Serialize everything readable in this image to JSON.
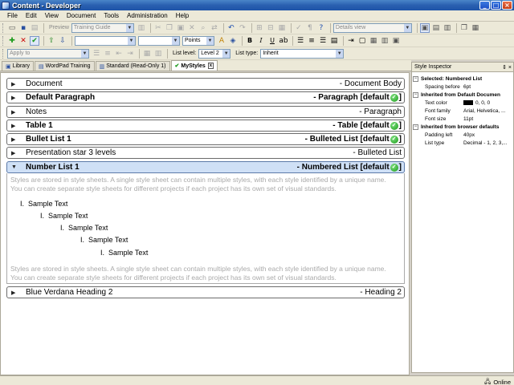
{
  "window": {
    "title": "Content - Developer",
    "buttons": {
      "minimize": "_",
      "maximize": "□",
      "close": "×"
    }
  },
  "menu": [
    "File",
    "Edit",
    "View",
    "Document",
    "Tools",
    "Administration",
    "Help"
  ],
  "toolbar1": {
    "preview_label": "Preview",
    "template_combo": "Training Guide",
    "view_combo": "Details view"
  },
  "toolbar2": {
    "style_combo": "",
    "size_combo": "",
    "units_combo": "Points",
    "bold": "B",
    "italic": "I",
    "underline": "U"
  },
  "toolbar3": {
    "apply_to_label": "Apply to",
    "list_level_label": "List level:",
    "list_level_value": "Level 2",
    "list_type_label": "List type:",
    "list_type_value": "Inherit"
  },
  "tabs": [
    {
      "label": "Library"
    },
    {
      "label": "WordPad Training"
    },
    {
      "label": "Standard (Read-Only 1)"
    },
    {
      "label": "MyStyles",
      "close": "x"
    }
  ],
  "sections": [
    {
      "name": "Document",
      "type": "- Document Body",
      "bold": false,
      "default": false
    },
    {
      "name": "Default Paragraph",
      "type": "- Paragraph [default",
      "bold": true,
      "default": true
    },
    {
      "name": "Notes",
      "type": "- Paragraph",
      "bold": false,
      "default": false
    },
    {
      "name": "Table 1",
      "type": "- Table [default",
      "bold": true,
      "default": true
    },
    {
      "name": "Bullet List 1",
      "type": "- Bulleted List [default",
      "bold": true,
      "default": true
    },
    {
      "name": "Presentation star 3 levels",
      "type": "- Bulleted List",
      "bold": false,
      "default": false
    },
    {
      "name": "Number List 1",
      "type": "- Numbered List [default",
      "bold": true,
      "default": true
    },
    {
      "name": "Blue Verdana Heading 2",
      "type": "- Heading 2",
      "bold": false,
      "default": false
    }
  ],
  "default_suffix": "]",
  "expanded": {
    "paragraph": "Styles are stored in style sheets. A single style sheet can contain multiple styles, with each style identified by a unique name. You can create separate style sheets for different projects if each project has its own set of visual standards.",
    "marker": "I.",
    "items": [
      "Sample Text",
      "Sample Text",
      "Sample Text",
      "Sample Text",
      "Sample Text"
    ]
  },
  "inspector": {
    "title": "Style Inspector",
    "header_buttons": "⇕ ×",
    "groups": [
      {
        "title": "Selected: Numbered List",
        "rows": [
          {
            "k": "Spacing before",
            "v": "6pt"
          }
        ]
      },
      {
        "title": "Inherited from Default Documen",
        "rows": [
          {
            "k": "Text color",
            "v": "0, 0, 0",
            "swatch": "#000000"
          },
          {
            "k": "Font family",
            "v": "Arial, Helvetica, ..."
          },
          {
            "k": "Font size",
            "v": "11pt"
          }
        ]
      },
      {
        "title": "Inherited from browser defaults",
        "rows": [
          {
            "k": "Padding left",
            "v": "40px"
          },
          {
            "k": "List type",
            "v": "Decimal - 1, 2, 3,..."
          }
        ]
      }
    ]
  },
  "status": {
    "online": "Online"
  },
  "colors": {
    "selected_section": "#cfe0f6",
    "check_green": "#1a9a1a",
    "titlebar": "#2a60b0"
  }
}
